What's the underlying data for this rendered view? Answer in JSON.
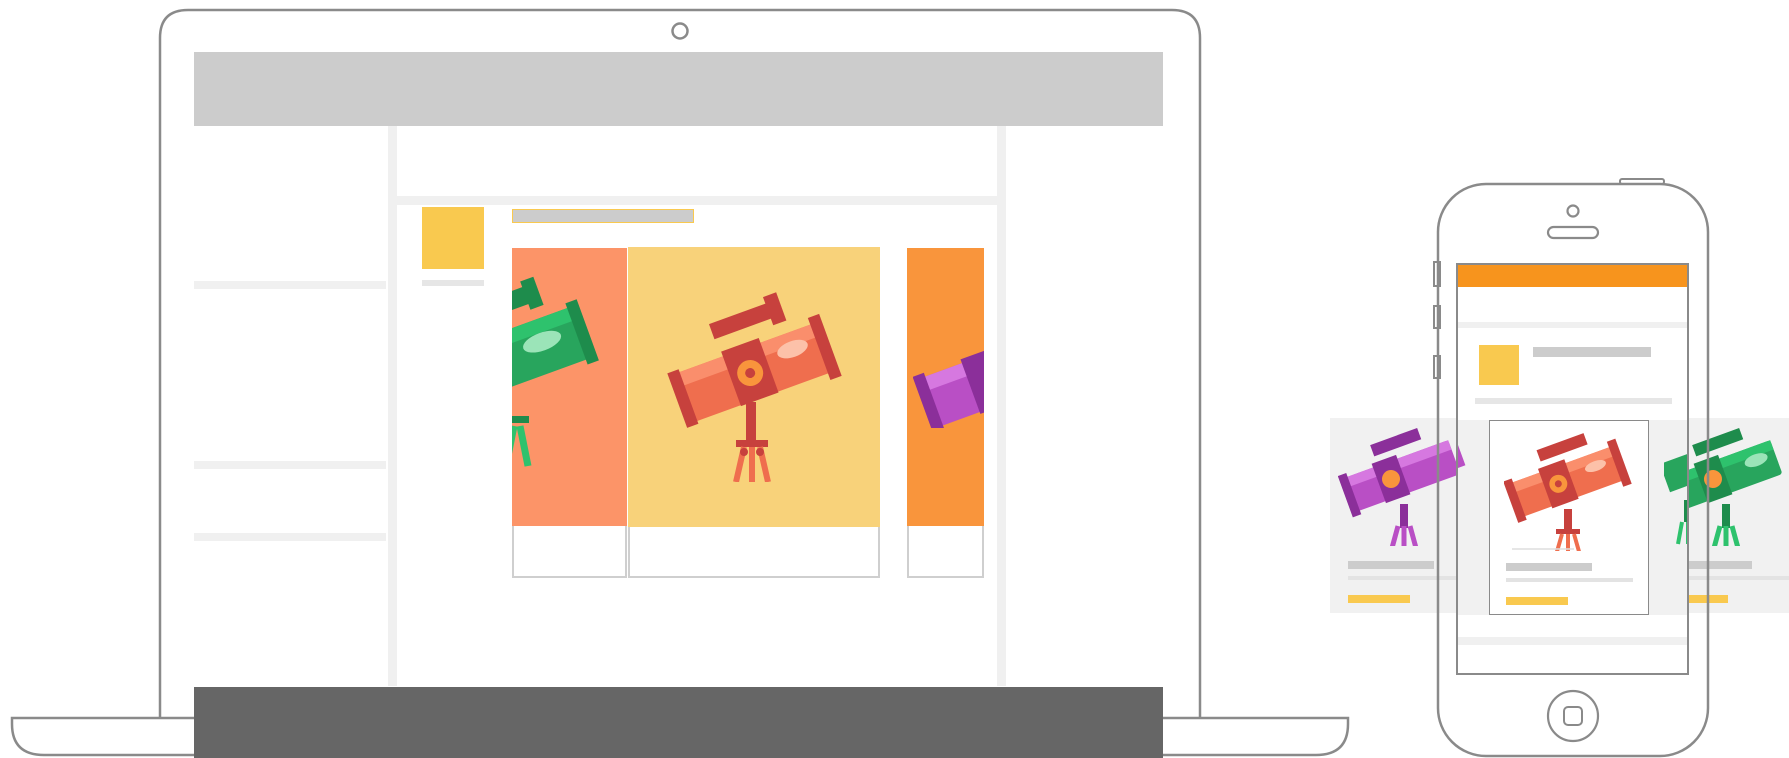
{
  "illustration": {
    "subject": "responsive-carousel-preview",
    "devices": [
      "laptop",
      "phone"
    ]
  },
  "colors": {
    "outline": "#8a8a8a",
    "header_gray": "#cccccc",
    "footer_gray": "#666666",
    "divider": "#f0f0f0",
    "accent_yellow": "#f9c94f",
    "card_orange": "#fc9468",
    "card_yellow": "#f8d27a",
    "card_deep_orange": "#f9953c",
    "phone_header": "#f7941d",
    "tray_gray": "#f1f1f1",
    "text_placeholder": "#cccccc"
  },
  "laptop": {
    "carousel": {
      "active_index": 1,
      "items": [
        {
          "icon": "telescope-green-icon",
          "bg": "#fc9468"
        },
        {
          "icon": "telescope-red-icon",
          "bg": "#f8d27a"
        },
        {
          "icon": "telescope-purple-icon",
          "bg": "#f9953c"
        }
      ]
    }
  },
  "phone": {
    "carousel": {
      "active_index": 1,
      "items": [
        {
          "icon": "telescope-purple-icon"
        },
        {
          "icon": "telescope-red-icon"
        },
        {
          "icon": "telescope-green-icon"
        }
      ]
    }
  }
}
